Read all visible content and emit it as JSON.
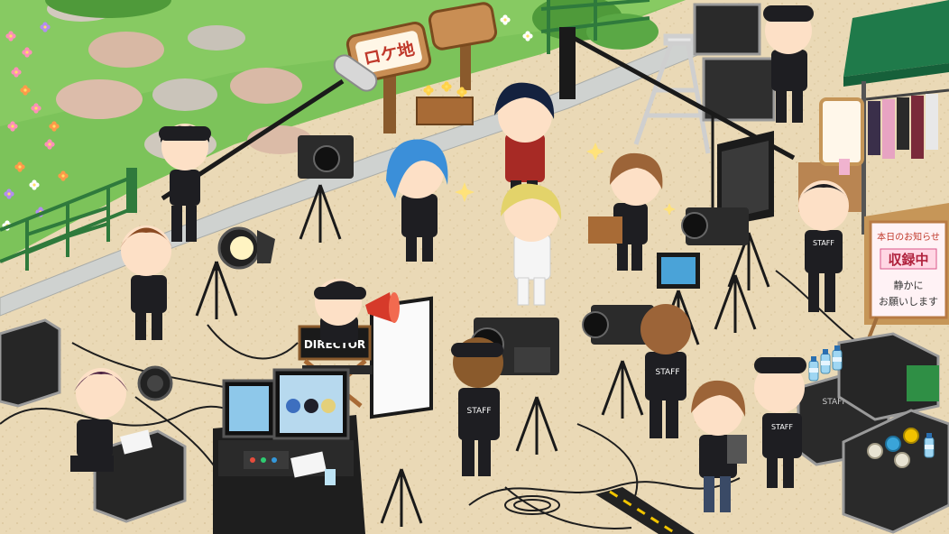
{
  "scene": {
    "title": "ロケ地",
    "chair_label": "DIRECTOR",
    "staff_label": "STAFF",
    "notice": {
      "heading": "本日のお知らせ",
      "status": "収録中",
      "line1": "静かに",
      "line2": "お願いします"
    }
  },
  "colors": {
    "grass": "#7cc35a",
    "path": "#e8d5b0",
    "fence": "#3f8f4a",
    "tent": "#1f7a4a",
    "staff_shirt": "#1e1e22"
  },
  "icons": [
    "boom-microphone-icon",
    "megaphone-icon",
    "film-light-icon",
    "video-camera-icon",
    "monitor-icon",
    "clapperboard-icon",
    "water-bottle-icon",
    "tape-roll-icon"
  ]
}
